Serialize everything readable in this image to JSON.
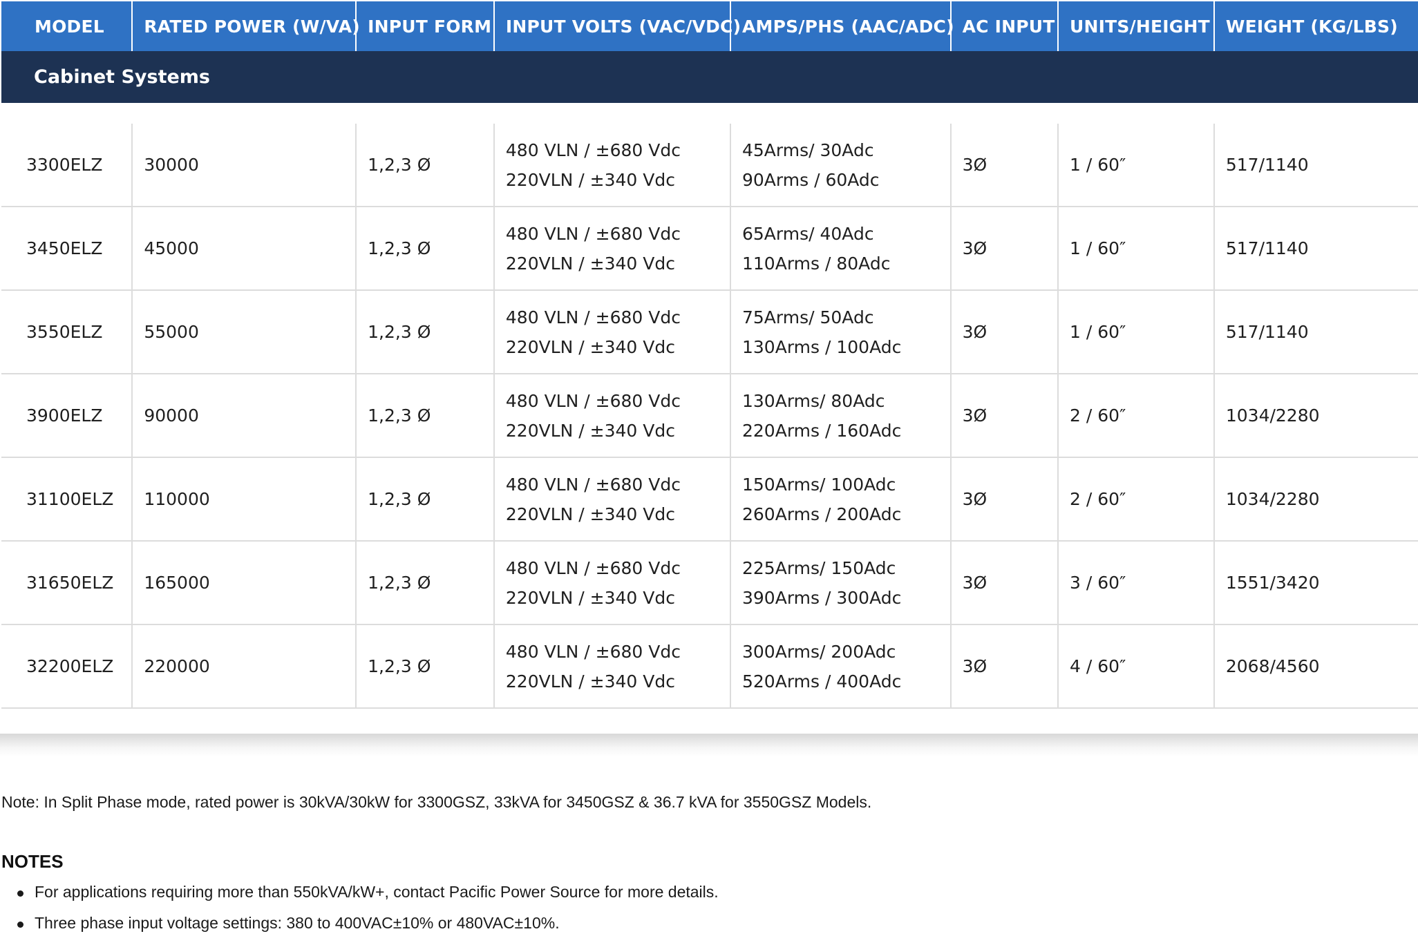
{
  "table": {
    "headers": [
      "MODEL",
      "RATED POWER (W/VA)",
      "INPUT FORM",
      "INPUT VOLTS (VAC/VDC)",
      "AMPS/PHS (AAC/ADC)",
      "AC INPUT",
      "UNITS/HEIGHT",
      "WEIGHT (KG/LBS)"
    ],
    "group_label": "Cabinet Systems",
    "rows": [
      {
        "model": "3300ELZ",
        "power": "30000",
        "input_form": "1,2,3 Ø",
        "volts_1": "480 VLN / ±680 Vdc",
        "volts_2": "220VLN / ±340 Vdc",
        "amps_1": "45Arms/ 30Adc",
        "amps_2": "90Arms / 60Adc",
        "ac_input": "3Ø",
        "units": "1 / 60″",
        "weight": "517/1140"
      },
      {
        "model": "3450ELZ",
        "power": "45000",
        "input_form": "1,2,3 Ø",
        "volts_1": "480 VLN / ±680 Vdc",
        "volts_2": "220VLN / ±340 Vdc",
        "amps_1": "65Arms/ 40Adc",
        "amps_2": "110Arms / 80Adc",
        "ac_input": "3Ø",
        "units": "1 / 60″",
        "weight": "517/1140"
      },
      {
        "model": "3550ELZ",
        "power": "55000",
        "input_form": "1,2,3 Ø",
        "volts_1": "480 VLN / ±680 Vdc",
        "volts_2": "220VLN / ±340 Vdc",
        "amps_1": "75Arms/ 50Adc",
        "amps_2": "130Arms / 100Adc",
        "ac_input": "3Ø",
        "units": "1 / 60″",
        "weight": "517/1140"
      },
      {
        "model": "3900ELZ",
        "power": "90000",
        "input_form": "1,2,3 Ø",
        "volts_1": "480 VLN / ±680 Vdc",
        "volts_2": "220VLN / ±340 Vdc",
        "amps_1": "130Arms/ 80Adc",
        "amps_2": "220Arms / 160Adc",
        "ac_input": "3Ø",
        "units": "2 / 60″",
        "weight": "1034/2280"
      },
      {
        "model": "31100ELZ",
        "power": "110000",
        "input_form": "1,2,3 Ø",
        "volts_1": "480 VLN / ±680 Vdc",
        "volts_2": "220VLN / ±340 Vdc",
        "amps_1": "150Arms/ 100Adc",
        "amps_2": "260Arms / 200Adc",
        "ac_input": "3Ø",
        "units": "2 / 60″",
        "weight": "1034/2280"
      },
      {
        "model": "31650ELZ",
        "power": "165000",
        "input_form": "1,2,3 Ø",
        "volts_1": "480 VLN / ±680 Vdc",
        "volts_2": "220VLN / ±340 Vdc",
        "amps_1": "225Arms/ 150Adc",
        "amps_2": "390Arms / 300Adc",
        "ac_input": "3Ø",
        "units": "3 / 60″",
        "weight": "1551/3420"
      },
      {
        "model": "32200ELZ",
        "power": "220000",
        "input_form": "1,2,3 Ø",
        "volts_1": "480 VLN / ±680 Vdc",
        "volts_2": "220VLN / ±340 Vdc",
        "amps_1": "300Arms/ 200Adc",
        "amps_2": "520Arms / 400Adc",
        "ac_input": "3Ø",
        "units": "4 / 60″",
        "weight": "2068/4560"
      }
    ]
  },
  "note": "Note: In Split Phase mode, rated power is 30kVA/30kW for 3300GSZ, 33kVA for 3450GSZ & 36.7 kVA for 3550GSZ Models.",
  "notes": {
    "heading": "NOTES",
    "items": [
      "For applications requiring more than 550kVA/kW+, contact Pacific Power Source for more details.",
      "Three phase input voltage settings: 380 to 400VAC±10% or 480VAC±10%."
    ]
  },
  "colors": {
    "header_blue": "#2f72c4",
    "group_navy": "#1d3253",
    "grid_line": "#dcdcdc"
  }
}
